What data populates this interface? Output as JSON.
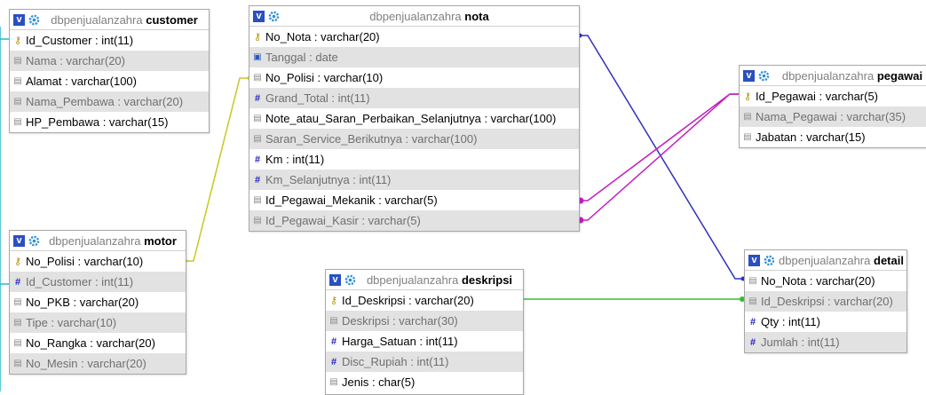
{
  "colors": {
    "customer_motor": "#2ab8c8",
    "motor_nota": "#c8c820",
    "nota_detail": "#3030c0",
    "nota_pegawai": "#c020c0",
    "deskripsi_detail": "#30c030"
  },
  "tables": {
    "customer": {
      "db": "dbpenjualanzahra",
      "name": "customer",
      "columns": [
        {
          "label": "Id_Customer : int(11)",
          "icon": "key"
        },
        {
          "label": "Nama : varchar(20)",
          "icon": "txt"
        },
        {
          "label": "Alamat : varchar(100)",
          "icon": "txt"
        },
        {
          "label": "Nama_Pembawa : varchar(20)",
          "icon": "txt"
        },
        {
          "label": "HP_Pembawa : varchar(15)",
          "icon": "txt"
        }
      ]
    },
    "nota": {
      "db": "dbpenjualanzahra",
      "name": "nota",
      "columns": [
        {
          "label": "No_Nota : varchar(20)",
          "icon": "key"
        },
        {
          "label": "Tanggal : date",
          "icon": "date"
        },
        {
          "label": "No_Polisi : varchar(10)",
          "icon": "txt"
        },
        {
          "label": "Grand_Total : int(11)",
          "icon": "num"
        },
        {
          "label": "Note_atau_Saran_Perbaikan_Selanjutnya : varchar(100)",
          "icon": "txt"
        },
        {
          "label": "Saran_Service_Berikutnya : varchar(100)",
          "icon": "txt"
        },
        {
          "label": "Km : int(11)",
          "icon": "num"
        },
        {
          "label": "Km_Selanjutnya : int(11)",
          "icon": "num"
        },
        {
          "label": "Id_Pegawai_Mekanik : varchar(5)",
          "icon": "txt"
        },
        {
          "label": "Id_Pegawai_Kasir : varchar(5)",
          "icon": "txt"
        }
      ]
    },
    "pegawai": {
      "db": "dbpenjualanzahra",
      "name": "pegawai",
      "columns": [
        {
          "label": "Id_Pegawai : varchar(5)",
          "icon": "key"
        },
        {
          "label": "Nama_Pegawai : varchar(35)",
          "icon": "txt"
        },
        {
          "label": "Jabatan : varchar(15)",
          "icon": "txt"
        }
      ]
    },
    "motor": {
      "db": "dbpenjualanzahra",
      "name": "motor",
      "columns": [
        {
          "label": "No_Polisi : varchar(10)",
          "icon": "key"
        },
        {
          "label": "Id_Customer : int(11)",
          "icon": "num"
        },
        {
          "label": "No_PKB : varchar(20)",
          "icon": "txt"
        },
        {
          "label": "Tipe : varchar(10)",
          "icon": "txt"
        },
        {
          "label": "No_Rangka : varchar(20)",
          "icon": "txt"
        },
        {
          "label": "No_Mesin : varchar(20)",
          "icon": "txt"
        }
      ]
    },
    "deskripsi": {
      "db": "dbpenjualanzahra",
      "name": "deskripsi",
      "columns": [
        {
          "label": "Id_Deskripsi : varchar(20)",
          "icon": "key"
        },
        {
          "label": "Deskripsi : varchar(30)",
          "icon": "txt"
        },
        {
          "label": "Harga_Satuan : int(11)",
          "icon": "num"
        },
        {
          "label": "Disc_Rupiah : int(11)",
          "icon": "num"
        },
        {
          "label": "Jenis : char(5)",
          "icon": "txt"
        }
      ]
    },
    "detail": {
      "db": "dbpenjualanzahra",
      "name": "detail",
      "columns": [
        {
          "label": "No_Nota : varchar(20)",
          "icon": "txt"
        },
        {
          "label": "Id_Deskripsi : varchar(20)",
          "icon": "txt"
        },
        {
          "label": "Qty : int(11)",
          "icon": "num"
        },
        {
          "label": "Jumlah : int(11)",
          "icon": "num"
        }
      ]
    }
  }
}
